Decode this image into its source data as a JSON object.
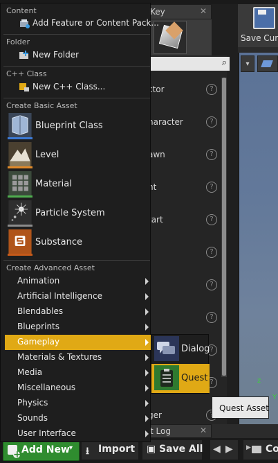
{
  "background": {
    "tab_key_label": "Key",
    "tab_close": "✕",
    "toolbar_save_label": "Save Curr",
    "place_items": [
      "ctor",
      "haracter",
      "awn",
      "ht",
      "tart",
      "",
      "",
      "",
      "",
      "",
      "ger"
    ],
    "help_glyph": "?",
    "search_glyph": "⌕",
    "axis_z": "z",
    "axis_y": "Y",
    "log_tab_label": "t Log",
    "vp_dropdown_glyph": "▾"
  },
  "menu": {
    "content_header": "Content",
    "add_feature_label": "Add Feature or Content Pack...",
    "folder_header": "Folder",
    "new_folder_label": "New Folder",
    "cpp_header": "C++ Class",
    "new_cpp_label": "New C++ Class...",
    "basic_header": "Create Basic Asset",
    "basic_items": [
      "Blueprint Class",
      "Level",
      "Material",
      "Particle System",
      "Substance"
    ],
    "advanced_header": "Create Advanced Asset",
    "advanced_items": [
      "Animation",
      "Artificial Intelligence",
      "Blendables",
      "Blueprints",
      "Gameplay",
      "Materials & Textures",
      "Media",
      "Miscellaneous",
      "Physics",
      "Sounds",
      "User Interface"
    ],
    "active_item": "Gameplay"
  },
  "submenu": {
    "items": [
      "Dialog",
      "Quest"
    ],
    "active_item": "Quest"
  },
  "tooltip": "Quest Asset",
  "bottom_bar": {
    "add_new_label": "Add New",
    "add_new_arrow": "▾",
    "import_label": "Import",
    "import_glyph": "⭳",
    "save_all_label": "Save All",
    "save_all_glyph": "▣",
    "back_glyph": "◀",
    "forward_glyph": "▶",
    "crumb_arrow": "▶",
    "crumb_label": "Co"
  },
  "colors": {
    "accent_highlight": "#e0a915",
    "add_new_green": "#2f8c2f",
    "menu_bg": "#1e1e1e"
  }
}
